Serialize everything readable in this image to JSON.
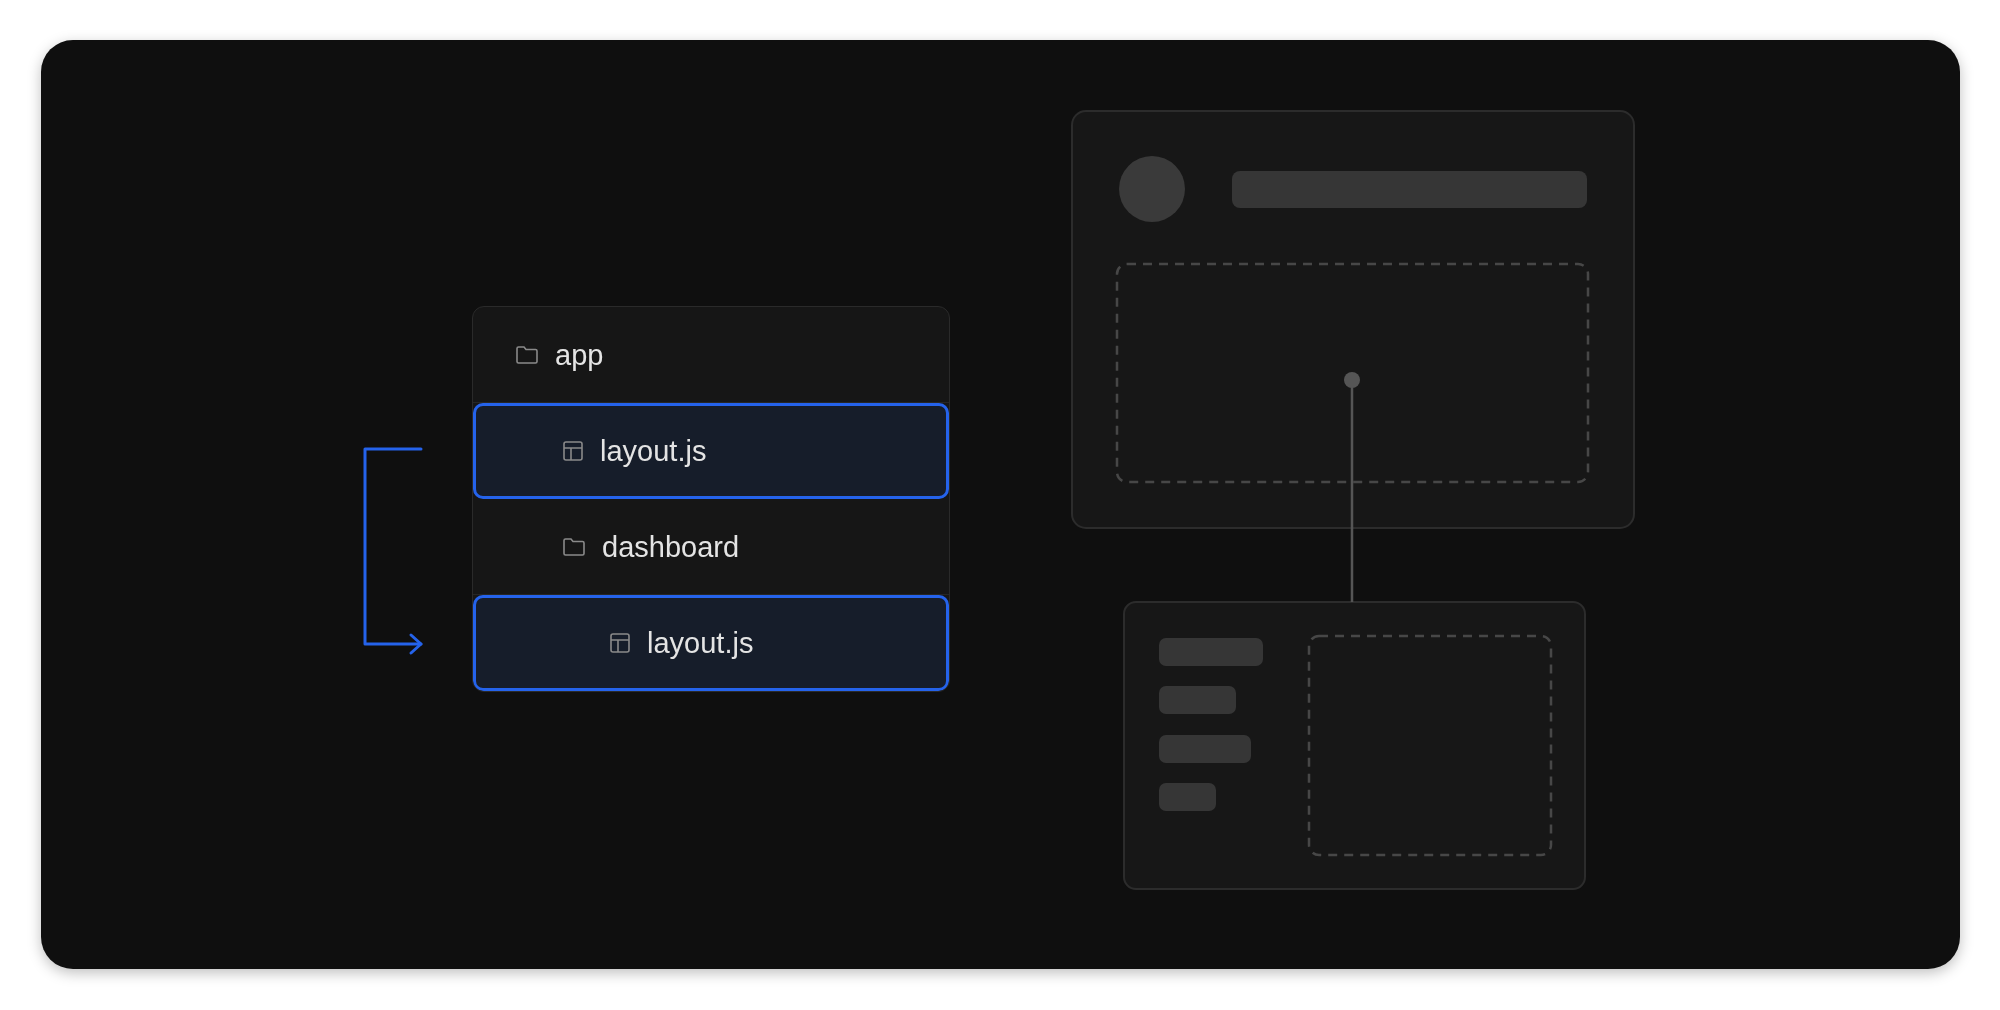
{
  "tree": {
    "items": [
      {
        "kind": "folder",
        "label": "app",
        "selected": false,
        "children": [
          {
            "kind": "file",
            "label": "layout.js",
            "selected": true
          },
          {
            "kind": "folder",
            "label": "dashboard",
            "selected": false,
            "children": [
              {
                "kind": "file",
                "label": "layout.js",
                "selected": true
              }
            ]
          }
        ]
      }
    ]
  }
}
